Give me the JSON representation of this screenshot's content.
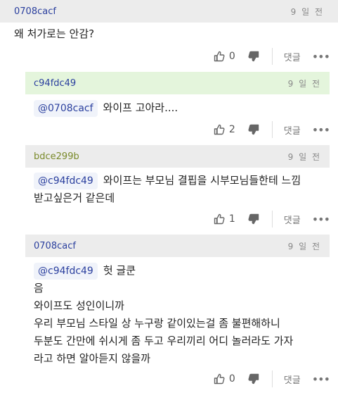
{
  "comments": [
    {
      "author": "0708cacf",
      "time": "9 일 전",
      "mention": "",
      "lines": [
        "왜 처가로는 안감?"
      ],
      "likes": "0",
      "reply_label": "댓글",
      "more": "•••"
    },
    {
      "author": "c94fdc49",
      "time": "9 일 전",
      "mention": "@0708cacf",
      "lines": [
        "와이프 고아라...."
      ],
      "likes": "2",
      "reply_label": "댓글",
      "more": "•••"
    },
    {
      "author": "bdce299b",
      "time": "9 일 전",
      "mention": "@c94fdc49",
      "lines": [
        "와이프는 부모님 결핍을 시부모님들한테 느낌",
        "받고싶은거 같은데"
      ],
      "likes": "1",
      "reply_label": "댓글",
      "more": "•••"
    },
    {
      "author": "0708cacf",
      "time": "9 일 전",
      "mention": "@c94fdc49",
      "lines": [
        "헛 글쿤",
        "음",
        "와이프도 성인이니까",
        "우리 부모님 스타일 상 누구랑 같이있는걸 좀 불편해하니",
        "두분도 간만에 쉬시게 좀 두고 우리끼리 어디 놀러라도 가자",
        "라고 하면 알아듣지 않을까"
      ],
      "likes": "0",
      "reply_label": "댓글",
      "more": "•••"
    }
  ]
}
